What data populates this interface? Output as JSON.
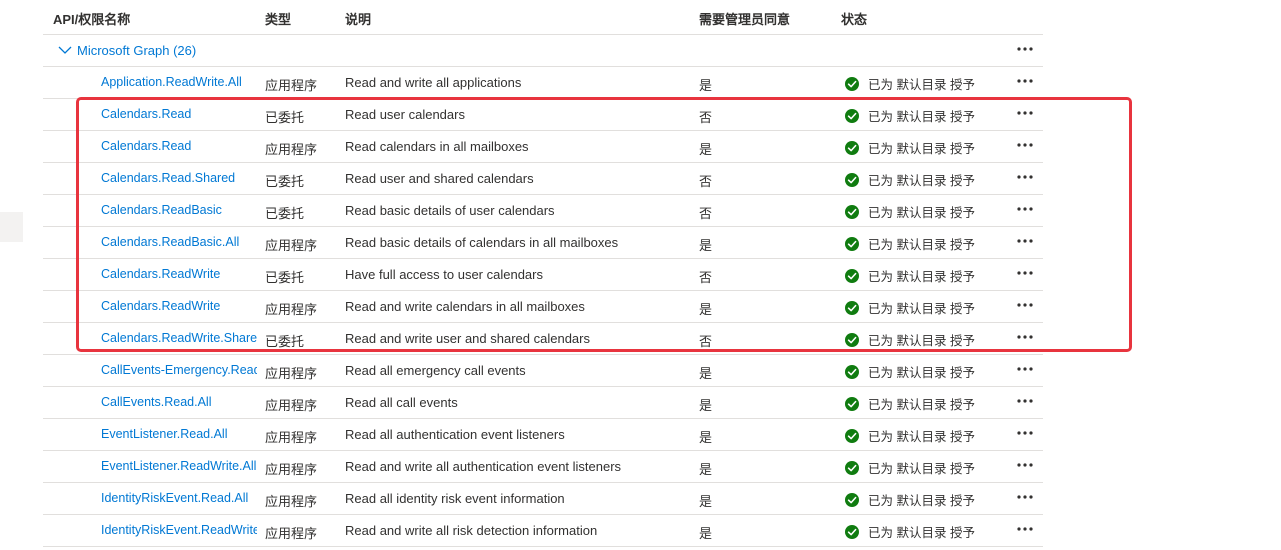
{
  "columns": {
    "name": "API/权限名称",
    "type": "类型",
    "description": "说明",
    "admin_consent": "需要管理员同意",
    "status": "状态"
  },
  "group": {
    "label": "Microsoft Graph (26)"
  },
  "icons": {
    "expand": "chevron-down-icon",
    "status": "check-circle-icon",
    "more": "more-options-icon"
  },
  "colors": {
    "link": "#0078d4",
    "success": "#107c10",
    "highlight": "#e8343e"
  },
  "rows": [
    {
      "name": "Application.ReadWrite.All",
      "type": "应用程序",
      "description": "Read and write all applications",
      "admin": "是",
      "status": "已为 默认目录 授予"
    },
    {
      "name": "Calendars.Read",
      "type": "已委托",
      "description": "Read user calendars",
      "admin": "否",
      "status": "已为 默认目录 授予"
    },
    {
      "name": "Calendars.Read",
      "type": "应用程序",
      "description": "Read calendars in all mailboxes",
      "admin": "是",
      "status": "已为 默认目录 授予"
    },
    {
      "name": "Calendars.Read.Shared",
      "type": "已委托",
      "description": "Read user and shared calendars",
      "admin": "否",
      "status": "已为 默认目录 授予"
    },
    {
      "name": "Calendars.ReadBasic",
      "type": "已委托",
      "description": "Read basic details of user calendars",
      "admin": "否",
      "status": "已为 默认目录 授予"
    },
    {
      "name": "Calendars.ReadBasic.All",
      "type": "应用程序",
      "description": "Read basic details of calendars in all mailboxes",
      "admin": "是",
      "status": "已为 默认目录 授予"
    },
    {
      "name": "Calendars.ReadWrite",
      "type": "已委托",
      "description": "Have full access to user calendars",
      "admin": "否",
      "status": "已为 默认目录 授予"
    },
    {
      "name": "Calendars.ReadWrite",
      "type": "应用程序",
      "description": "Read and write calendars in all mailboxes",
      "admin": "是",
      "status": "已为 默认目录 授予"
    },
    {
      "name": "Calendars.ReadWrite.Shared",
      "type": "已委托",
      "description": "Read and write user and shared calendars",
      "admin": "否",
      "status": "已为 默认目录 授予"
    },
    {
      "name": "CallEvents-Emergency.Read.All",
      "type": "应用程序",
      "description": "Read all emergency call events",
      "admin": "是",
      "status": "已为 默认目录 授予"
    },
    {
      "name": "CallEvents.Read.All",
      "type": "应用程序",
      "description": "Read all call events",
      "admin": "是",
      "status": "已为 默认目录 授予"
    },
    {
      "name": "EventListener.Read.All",
      "type": "应用程序",
      "description": "Read all authentication event listeners",
      "admin": "是",
      "status": "已为 默认目录 授予"
    },
    {
      "name": "EventListener.ReadWrite.All",
      "type": "应用程序",
      "description": "Read and write all authentication event listeners",
      "admin": "是",
      "status": "已为 默认目录 授予"
    },
    {
      "name": "IdentityRiskEvent.Read.All",
      "type": "应用程序",
      "description": "Read all identity risk event information",
      "admin": "是",
      "status": "已为 默认目录 授予"
    },
    {
      "name": "IdentityRiskEvent.ReadWrite.All",
      "type": "应用程序",
      "description": "Read and write all risk detection information",
      "admin": "是",
      "status": "已为 默认目录 授予"
    }
  ]
}
